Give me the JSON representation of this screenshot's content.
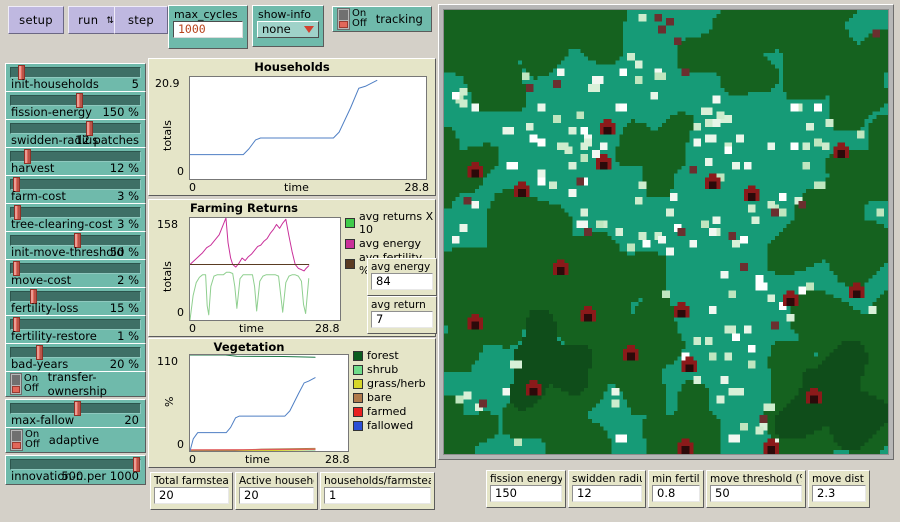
{
  "toolbar": {
    "setup_label": "setup",
    "run_label": "run",
    "run_forever_icon": "loop-icon",
    "step_label": "step",
    "max_cycles": {
      "label": "max_cycles",
      "value": "1000"
    },
    "show_info": {
      "label": "show-info",
      "value": "none",
      "caret_icon": "chevron-down-icon"
    },
    "tracking": {
      "label": "tracking",
      "on_label": "On",
      "off_label": "Off",
      "state": "off"
    }
  },
  "sliders": [
    {
      "name": "init-households",
      "value": "5",
      "pct": 6
    },
    {
      "name": "fission-energy",
      "value": "150 %",
      "pct": 52
    },
    {
      "name": "swidden-radius",
      "value": "12 patches",
      "pct": 60
    },
    {
      "name": "harvest",
      "value": "12 %",
      "pct": 11
    },
    {
      "name": "farm-cost",
      "value": "3 %",
      "pct": 2
    },
    {
      "name": "tree-clearing-cost",
      "value": "3 %",
      "pct": 3
    },
    {
      "name": "init-move-threshold",
      "value": "50 %",
      "pct": 51
    },
    {
      "name": "move-cost",
      "value": "2 %",
      "pct": 2
    },
    {
      "name": "fertility-loss",
      "value": "15 %",
      "pct": 16
    },
    {
      "name": "fertility-restore",
      "value": "1 %",
      "pct": 2
    },
    {
      "name": "bad-years",
      "value": "20 %",
      "pct": 21
    }
  ],
  "switches": [
    {
      "name": "transfer-ownership",
      "on_label": "On",
      "off_label": "Off",
      "state": "off"
    },
    {
      "name": "adaptive",
      "on_label": "On",
      "off_label": "Off",
      "state": "off"
    }
  ],
  "sliders2": [
    {
      "name": "max-fallow",
      "value": "20",
      "pct": 51
    },
    {
      "name": "innovation-r...",
      "value": "500 per 1000",
      "pct": 98
    }
  ],
  "chart_data": [
    {
      "type": "line",
      "title": "Households",
      "xlabel": "time",
      "ylabel": "totals",
      "xlim": [
        0,
        28.8
      ],
      "ylim": [
        0,
        20.9
      ],
      "xticks": [
        "0",
        "28.8"
      ],
      "yticks": [
        "0",
        "20.9"
      ],
      "grid": false,
      "legend": [],
      "series": [
        {
          "name": "households",
          "color": "#4f7fc4",
          "x": [
            0.0,
            6.5,
            7.2,
            8.0,
            8.6,
            17.5,
            18.2,
            19.6,
            20.6,
            21.4,
            22.8
          ],
          "y": [
            5.0,
            5.0,
            6.2,
            8.0,
            8.4,
            8.4,
            9.6,
            14.6,
            18.6,
            19.0,
            20.2
          ]
        }
      ]
    },
    {
      "type": "line",
      "title": "Farming Returns",
      "xlabel": "time",
      "ylabel": "totals",
      "xlim": [
        0,
        28.8
      ],
      "ylim": [
        0,
        158
      ],
      "xticks": [
        "0",
        "28.8"
      ],
      "yticks": [
        "0",
        "158"
      ],
      "grid": false,
      "legend": [
        {
          "label": "avg returns X 10",
          "color": "#3fcb4a"
        },
        {
          "label": "avg energy",
          "color": "#c9309a"
        },
        {
          "label": "avg fertility %",
          "color": "#5a3b22"
        }
      ],
      "series": [
        {
          "name": "avg returns X 10",
          "color": "#8fcf8f",
          "x": [
            0.0,
            0.6,
            1.2,
            1.8,
            2.4,
            3.0,
            3.3,
            3.6,
            4.0,
            4.6,
            5.2,
            5.8,
            6.4,
            7.0,
            7.6,
            8.2,
            8.6,
            9.0,
            9.6,
            10.2,
            10.8,
            11.4,
            12.0,
            12.4,
            12.8,
            13.4,
            14.0,
            14.6,
            15.2,
            15.8,
            16.4,
            17.0,
            17.4,
            17.8,
            18.4,
            19.0,
            19.6,
            20.2,
            20.8,
            21.4,
            21.8,
            22.2,
            22.8
          ],
          "y": [
            0,
            38,
            58,
            66,
            70,
            70,
            22,
            8,
            52,
            68,
            70,
            70,
            70,
            74,
            74,
            72,
            52,
            18,
            64,
            70,
            70,
            70,
            70,
            52,
            14,
            60,
            68,
            70,
            70,
            70,
            70,
            68,
            40,
            12,
            58,
            68,
            70,
            70,
            68,
            60,
            24,
            10,
            64
          ]
        },
        {
          "name": "avg energy",
          "color": "#c9309a",
          "x": [
            0.0,
            0.8,
            1.6,
            2.4,
            3.2,
            4.0,
            4.8,
            5.6,
            6.4,
            6.9,
            7.3,
            7.8,
            8.2,
            8.8,
            9.4,
            10.0,
            10.6,
            11.2,
            11.8,
            12.4,
            13.0,
            13.6,
            14.2,
            14.8,
            15.4,
            16.0,
            16.6,
            17.2,
            17.8,
            18.4,
            19.0,
            19.6,
            20.2,
            20.8,
            21.4,
            21.9,
            22.3,
            22.8
          ],
          "y": [
            86,
            92,
            98,
            104,
            112,
            116,
            124,
            132,
            148,
            158,
            120,
            96,
            86,
            82,
            88,
            96,
            92,
            98,
            102,
            108,
            114,
            116,
            122,
            126,
            134,
            140,
            148,
            142,
            150,
            156,
            130,
            106,
            86,
            80,
            78,
            76,
            80,
            84
          ]
        },
        {
          "name": "avg fertility %",
          "color": "#5a3b22",
          "x": [
            0.0,
            22.8
          ],
          "y": [
            86,
            86
          ]
        }
      ]
    },
    {
      "type": "line",
      "title": "Vegetation",
      "xlabel": "time",
      "ylabel": "%",
      "xlim": [
        0,
        28.8
      ],
      "ylim": [
        0,
        110
      ],
      "xticks": [
        "0",
        "28.8"
      ],
      "yticks": [
        "0",
        "110"
      ],
      "grid": false,
      "legend": [
        {
          "label": "forest",
          "color": "#0a5c1f"
        },
        {
          "label": "shrub",
          "color": "#6fdc8a"
        },
        {
          "label": "grass/herb",
          "color": "#d6d62a"
        },
        {
          "label": "bare",
          "color": "#b07a4b"
        },
        {
          "label": "farmed",
          "color": "#e82020"
        },
        {
          "label": "fallowed",
          "color": "#2b4fd6"
        }
      ],
      "series": [
        {
          "name": "forest",
          "color": "#1d7a45",
          "x": [
            0,
            2,
            6.5,
            8.5,
            12,
            17,
            20,
            22.8
          ],
          "y": [
            110,
            110,
            110,
            108.6,
            108.4,
            108.3,
            107.8,
            107.4
          ]
        },
        {
          "name": "shrub",
          "color": "#8fcf8f",
          "x": [
            0,
            22.8
          ],
          "y": [
            0.6,
            1.0
          ]
        },
        {
          "name": "grass/herb",
          "color": "#d6d62a",
          "x": [
            0,
            14,
            20,
            22.8
          ],
          "y": [
            0.2,
            0.4,
            1.2,
            2.0
          ]
        },
        {
          "name": "bare",
          "color": "#b07a4b",
          "x": [
            0,
            8,
            13,
            18,
            22.8
          ],
          "y": [
            0.3,
            0.6,
            2.2,
            2.6,
            3.0
          ]
        },
        {
          "name": "farmed",
          "color": "#e05a5a",
          "x": [
            0,
            10,
            22.8
          ],
          "y": [
            1.4,
            1.6,
            1.8
          ]
        },
        {
          "name": "fallowed",
          "color": "#4f7fc4",
          "x": [
            0,
            0.6,
            1.4,
            6.6,
            7.4,
            8.3,
            9.0,
            17.3,
            18.2,
            19.8,
            20.8,
            21.6,
            22.8
          ],
          "y": [
            0,
            14,
            21,
            21,
            27,
            38,
            40,
            40,
            46,
            66,
            78,
            80,
            84
          ]
        }
      ]
    }
  ],
  "plot_monitors": [
    {
      "label": "avg energy",
      "value": "84"
    },
    {
      "label": "avg return",
      "value": "7"
    }
  ],
  "bottom_monitors_left": [
    {
      "label": "Total farmsteads",
      "value": "20"
    },
    {
      "label": "Active households",
      "value": "20"
    },
    {
      "label": "households/farmstead",
      "value": "1"
    }
  ],
  "bottom_monitors_right": [
    {
      "label": "fission energy",
      "value": "150"
    },
    {
      "label": "swidden radius",
      "value": "12"
    },
    {
      "label": "min fertility",
      "value": "0.8"
    },
    {
      "label": "move threshold (%)",
      "value": "50"
    },
    {
      "label": "move dist",
      "value": "2.3"
    }
  ],
  "world": {
    "name": "simulation-world-view",
    "colors": {
      "shrub": "#169b77",
      "forest": "#15621f",
      "forest_dark": "#0f4d1a",
      "fallowed_light": "#ffffff",
      "fallowed_pale": "#cdeccd",
      "bare": "#6b2f2f",
      "farmstead": "#8b1a1a"
    }
  }
}
